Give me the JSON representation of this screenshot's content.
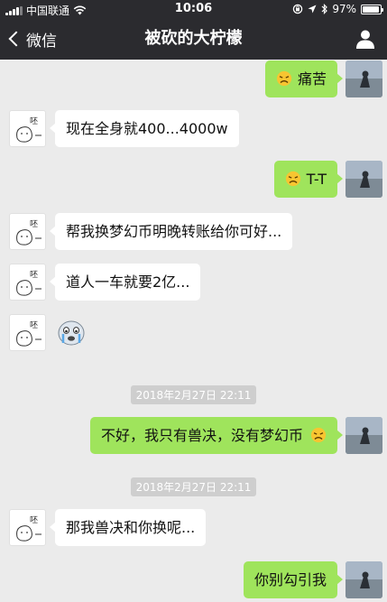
{
  "status_bar": {
    "carrier": "中国联通",
    "time": "10:06",
    "battery_percent": "97%",
    "battery_level": 0.97,
    "icons": [
      "signal-icon",
      "wifi-icon",
      "orientation-lock-icon",
      "location-icon",
      "bluetooth-icon",
      "battery-icon"
    ]
  },
  "nav": {
    "back_label": "微信",
    "title": "被砍的大柠檬",
    "user_icon": "person-icon"
  },
  "messages": [
    {
      "side": "out",
      "emoji": "sad-face",
      "text": "痛苦"
    },
    {
      "side": "in",
      "text": "现在全身就400...4000w"
    },
    {
      "side": "out",
      "emoji": "sad-face",
      "text": "T-T"
    },
    {
      "side": "in",
      "text": "帮我换梦幻币明晚转账给你可好..."
    },
    {
      "side": "in",
      "text": "道人一车就要2亿..."
    },
    {
      "side": "in",
      "sticker": "crying-sticker"
    },
    {
      "timestamp": "2018年2月27日 22:11"
    },
    {
      "side": "out",
      "text": "不好，我只有兽决，没有梦幻币",
      "emoji_after": "sad-face"
    },
    {
      "timestamp": "2018年2月27日 22:11"
    },
    {
      "side": "in",
      "text": "那我兽决和你换呢..."
    },
    {
      "side": "out",
      "text": "你别勾引我"
    }
  ],
  "colors": {
    "bar_background": "#2b2b2f",
    "chat_background": "#ebebeb",
    "outgoing_bubble": "#9fe45c",
    "incoming_bubble": "#ffffff",
    "timestamp_badge": "#cecece"
  }
}
